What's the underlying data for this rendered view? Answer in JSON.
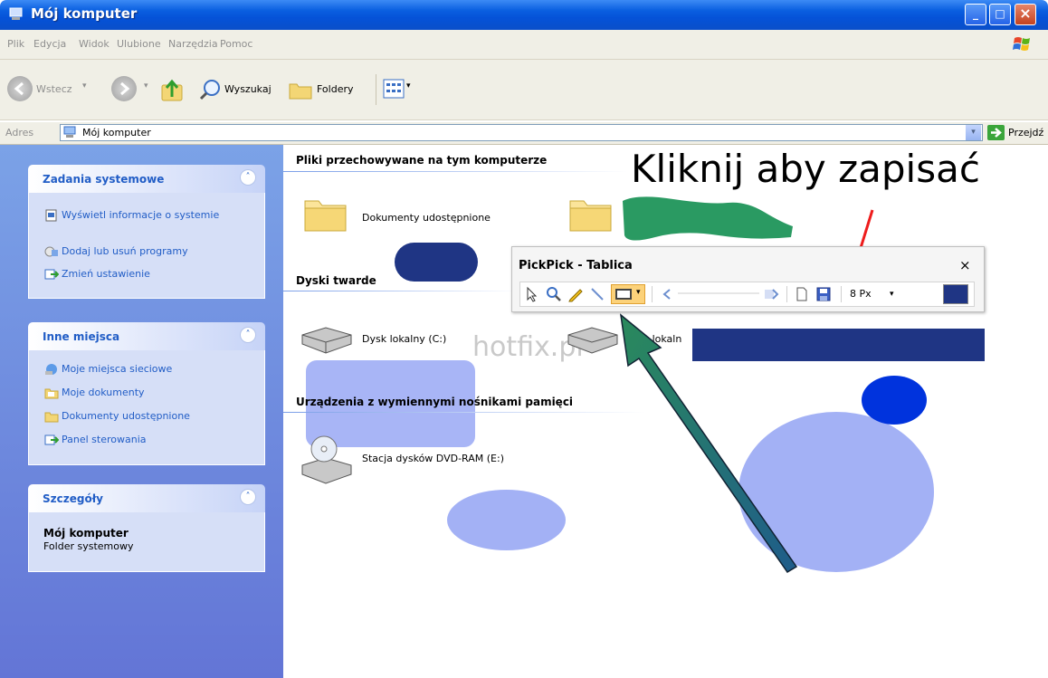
{
  "window": {
    "title": "Mój komputer"
  },
  "menu": [
    "Plik",
    "Edycja",
    "Widok",
    "Ulubione",
    "Narzędzia",
    "Pomoc"
  ],
  "toolbar": {
    "back": "Wstecz",
    "search": "Wyszukaj",
    "folders": "Foldery"
  },
  "address": {
    "label": "Adres",
    "value": "Mój komputer",
    "go": "Przejdź"
  },
  "left_pane": {
    "system_tasks": {
      "title": "Zadania systemowe",
      "items": [
        "Wyświetl informacje o systemie",
        "Dodaj lub usuń programy",
        "Zmień ustawienie"
      ]
    },
    "other_places": {
      "title": "Inne miejsca",
      "items": [
        "Moje miejsca sieciowe",
        "Moje dokumenty",
        "Dokumenty udostępnione",
        "Panel sterowania"
      ]
    },
    "details": {
      "title": "Szczegóły",
      "name": "Mój komputer",
      "type": "Folder systemowy"
    }
  },
  "content": {
    "groups": [
      {
        "title": "Pliki przechowywane na tym komputerze",
        "items": [
          "Dokumenty udostępnione"
        ]
      },
      {
        "title": "Dyski twarde",
        "items": [
          "Dysk lokalny (C:)",
          "Dysk lokaln"
        ]
      },
      {
        "title": "Urządzenia z wymiennymi nośnikami pamięci",
        "items": [
          "Stacja dysków DVD-RAM (E:)"
        ]
      }
    ]
  },
  "annotation": {
    "callout": "Kliknij aby zapisać",
    "watermark": "hotfix.pl"
  },
  "pickpick": {
    "title": "PickPick - Tablica",
    "close": "×",
    "size": "8 Px"
  },
  "colors": {
    "titlebar": "#0a5fe0",
    "navy_fill": "#1f3584",
    "lavender_fill": "#a3b1f5",
    "blue_fill": "#0033dd",
    "green_arrow": "#2a8a5c",
    "red_arrow": "#ee1c1c",
    "highlight_selection": "#fcd27a"
  },
  "icons": [
    "window-icon",
    "back-arrow-icon",
    "forward-arrow-icon",
    "up-folder-icon",
    "search-icon",
    "folders-icon",
    "views-icon",
    "go-icon",
    "folder-icon",
    "hard-drive-icon",
    "dvd-drive-icon",
    "windows-flag-icon"
  ]
}
